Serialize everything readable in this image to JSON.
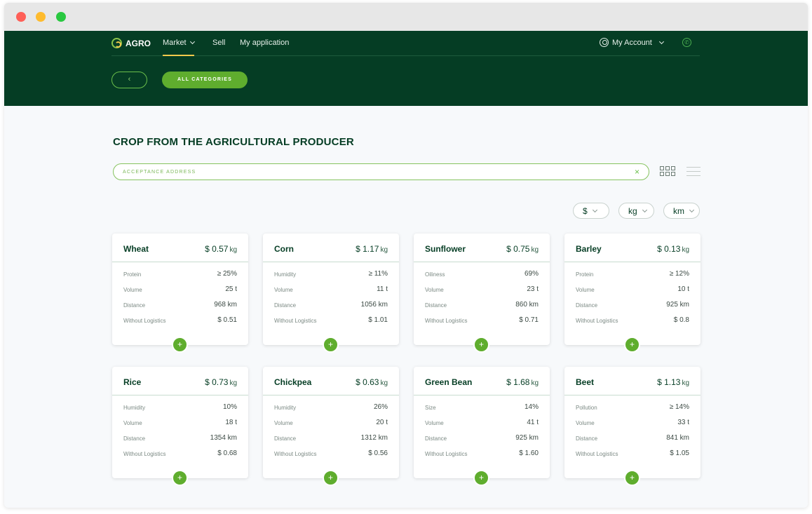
{
  "window": {
    "buttons": [
      "close",
      "minimize",
      "maximize"
    ]
  },
  "header": {
    "logo": "AGRO",
    "nav": {
      "market": "Market",
      "sell": "Sell",
      "my_application": "My application"
    },
    "account": "My Account",
    "back_icon": "‹",
    "all_categories": "ALL CATEGORIES"
  },
  "main": {
    "title": "CROP FROM THE AGRICULTURAL PRODUCER",
    "search": {
      "placeholder": "ACCEPTANCE ADDRESS",
      "value": "",
      "clear_icon": "×"
    },
    "filters": {
      "currency": "$",
      "weight": "kg",
      "distance": "km"
    }
  },
  "colors": {
    "header_bg": "#053d24",
    "accent_green": "#5fad2e",
    "accent_yellow": "#f2c94c",
    "text_dark": "#053d24"
  },
  "cards": [
    {
      "name": "Wheat",
      "price": "$ 0.57",
      "unit": "kg",
      "rows": [
        {
          "label": "Protein",
          "value": "≥ 25%"
        },
        {
          "label": "Volume",
          "value": "25 t"
        },
        {
          "label": "Distance",
          "value": "968 km"
        },
        {
          "label": "Without Logistics",
          "value": "$ 0.51"
        }
      ]
    },
    {
      "name": "Corn",
      "price": "$ 1.17",
      "unit": "kg",
      "rows": [
        {
          "label": "Humidity",
          "value": "≥ 11%"
        },
        {
          "label": "Volume",
          "value": "11 t"
        },
        {
          "label": "Distance",
          "value": "1056 km"
        },
        {
          "label": "Without Logistics",
          "value": "$ 1.01"
        }
      ]
    },
    {
      "name": "Sunflower",
      "price": "$ 0.75",
      "unit": "kg",
      "rows": [
        {
          "label": "Oiliness",
          "value": "69%"
        },
        {
          "label": "Volume",
          "value": "23 t"
        },
        {
          "label": "Distance",
          "value": "860 km"
        },
        {
          "label": "Without Logistics",
          "value": "$ 0.71"
        }
      ]
    },
    {
      "name": "Barley",
      "price": "$ 0.13",
      "unit": "kg",
      "rows": [
        {
          "label": "Protein",
          "value": "≥ 12%"
        },
        {
          "label": "Volume",
          "value": "10 t"
        },
        {
          "label": "Distance",
          "value": "925 km"
        },
        {
          "label": "Without Logistics",
          "value": "$ 0.8"
        }
      ]
    },
    {
      "name": "Rice",
      "price": "$ 0.73",
      "unit": "kg",
      "rows": [
        {
          "label": "Humidity",
          "value": "10%"
        },
        {
          "label": "Volume",
          "value": "18 t"
        },
        {
          "label": "Distance",
          "value": "1354 km"
        },
        {
          "label": "Without Logistics",
          "value": "$ 0.68"
        }
      ]
    },
    {
      "name": "Chickpea",
      "price": "$ 0.63",
      "unit": "kg",
      "rows": [
        {
          "label": "Humidity",
          "value": "26%"
        },
        {
          "label": "Volume",
          "value": "20 t"
        },
        {
          "label": "Distance",
          "value": "1312 km"
        },
        {
          "label": "Without Logistics",
          "value": "$ 0.56"
        }
      ]
    },
    {
      "name": "Green Bean",
      "price": "$ 1.68",
      "unit": "kg",
      "rows": [
        {
          "label": "Size",
          "value": "14%"
        },
        {
          "label": "Volume",
          "value": "41 t"
        },
        {
          "label": "Distance",
          "value": "925 km"
        },
        {
          "label": "Without Logistics",
          "value": "$ 1.60"
        }
      ]
    },
    {
      "name": "Beet",
      "price": "$ 1.13",
      "unit": "kg",
      "rows": [
        {
          "label": "Pollution",
          "value": "≥ 14%"
        },
        {
          "label": "Volume",
          "value": "33 t"
        },
        {
          "label": "Distance",
          "value": "841 km"
        },
        {
          "label": "Without Logistics",
          "value": "$ 1.05"
        }
      ]
    }
  ],
  "add_icon": "+"
}
